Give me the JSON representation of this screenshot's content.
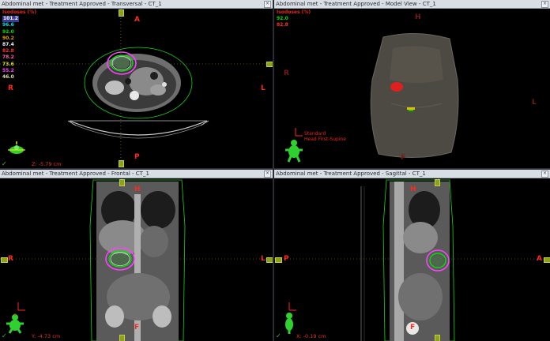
{
  "panes": {
    "transversal": {
      "title": "Abdominal met  -  Treatment Approved - Transversal - CT_1",
      "orient": {
        "top": "A",
        "bottom": "P",
        "left": "R",
        "right": "L"
      },
      "readout": "Z: -5.79 cm"
    },
    "model": {
      "title": "Abdominal met  -  Treatment Approved - Model View - CT_1",
      "orient": {
        "top": "H",
        "bottom": "F",
        "left": "R",
        "right": "L"
      },
      "orientation_line1": "Standard",
      "orientation_line2": "Head First-Supine"
    },
    "frontal": {
      "title": "Abdominal met  -  Treatment Approved - Frontal - CT_1",
      "orient": {
        "top": "H",
        "bottom": "F",
        "left": "R",
        "right": "L"
      },
      "readout": "Y: -4.73 cm"
    },
    "sagittal": {
      "title": "Abdominal met  -  Treatment Approved - Sagittal - CT_1",
      "orient": {
        "top": "H",
        "bottom": "F",
        "left": "P",
        "right": "A"
      },
      "readout": "X: -0.19 cm"
    }
  },
  "isodose_legend": {
    "header": "Isodoses (%)",
    "levels": [
      {
        "value": "101.2",
        "color": "#ffffff",
        "highlight": true
      },
      {
        "value": "96.6",
        "color": "#00e0e0"
      },
      {
        "value": "92.0",
        "color": "#00e000"
      },
      {
        "value": "90.2",
        "color": "#e0a000"
      },
      {
        "value": "87.4",
        "color": "#f0f0f0"
      },
      {
        "value": "82.8",
        "color": "#ff3030"
      },
      {
        "value": "78.2",
        "color": "#ff60a0"
      },
      {
        "value": "73.6",
        "color": "#e0e000"
      },
      {
        "value": "55.2",
        "color": "#ff40ff"
      },
      {
        "value": "46.0",
        "color": "#e0e0a0"
      }
    ]
  },
  "model_legend": {
    "header": "Isodoses (%)",
    "levels": [
      {
        "value": "92.0",
        "color": "#00e000"
      },
      {
        "value": "82.8",
        "color": "#ff3030"
      }
    ]
  },
  "colors": {
    "orientation_label": "#ff2a1e",
    "body_contour": "#17d61a",
    "crosshair": "#8ea01f",
    "ptv": "#ff40ff"
  }
}
